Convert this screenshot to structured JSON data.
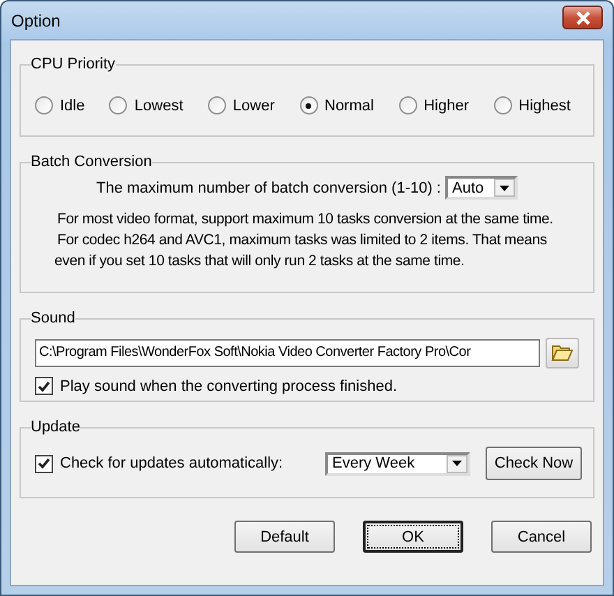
{
  "window": {
    "title": "Option"
  },
  "cpu_priority": {
    "title": "CPU Priority",
    "options": [
      {
        "label": "Idle",
        "selected": false
      },
      {
        "label": "Lowest",
        "selected": false
      },
      {
        "label": "Lower",
        "selected": false
      },
      {
        "label": "Normal",
        "selected": true
      },
      {
        "label": "Higher",
        "selected": false
      },
      {
        "label": "Highest",
        "selected": false
      }
    ]
  },
  "batch_conversion": {
    "title": "Batch Conversion",
    "label": "The maximum number of batch conversion (1-10) :",
    "value": "Auto",
    "notes": [
      "For most video format, support maximum 10 tasks conversion at the same time.",
      "For codec h264 and AVC1, maximum tasks was limited to 2 items. That means",
      "even if you set 10 tasks that will only run 2 tasks at the same time."
    ]
  },
  "sound": {
    "title": "Sound",
    "path": "C:\\Program Files\\WonderFox Soft\\Nokia Video Converter Factory Pro\\Cor",
    "play_sound": {
      "label": "Play sound when the converting process finished.",
      "checked": true
    }
  },
  "update": {
    "title": "Update",
    "auto_check": {
      "label": "Check for updates automatically:",
      "checked": true
    },
    "frequency": "Every Week",
    "check_now": "Check Now"
  },
  "buttons": [
    {
      "label": "Default",
      "focused": false
    },
    {
      "label": "OK",
      "focused": true
    },
    {
      "label": "Cancel",
      "focused": false
    }
  ]
}
